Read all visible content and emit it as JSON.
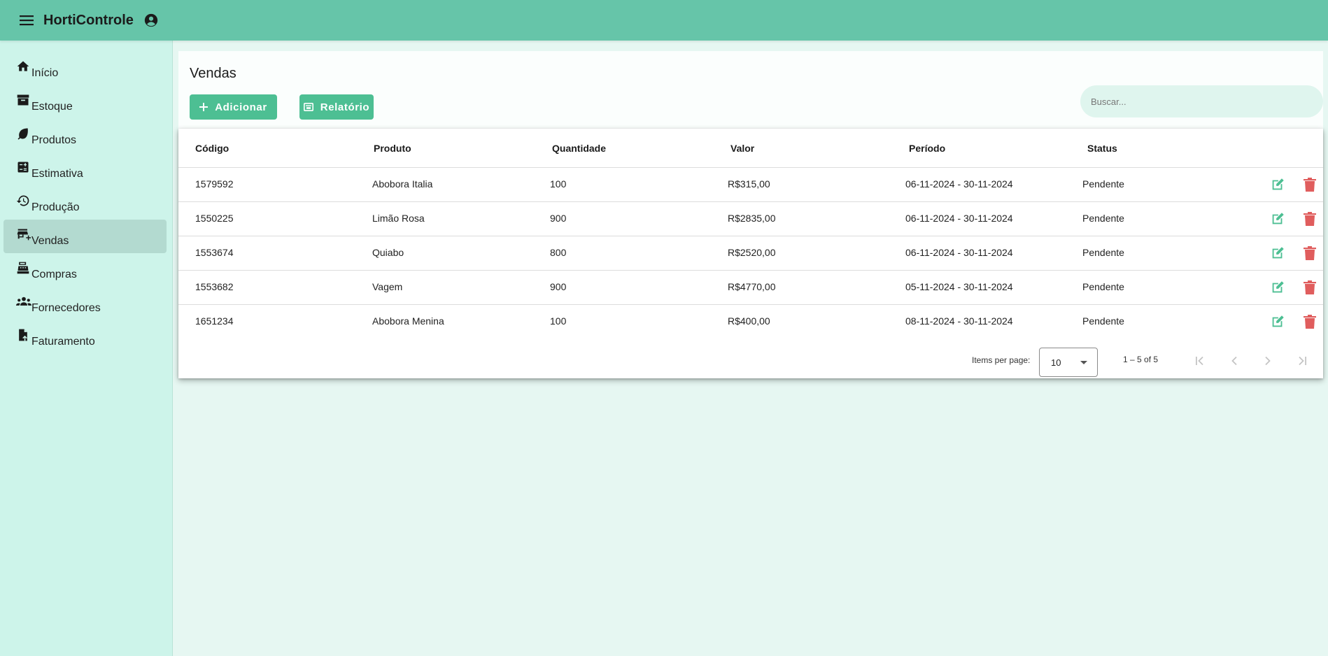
{
  "app": {
    "title": "HortiControle"
  },
  "sidebar": {
    "items": [
      {
        "label": "Início",
        "icon": "home-icon"
      },
      {
        "label": "Estoque",
        "icon": "archive-icon"
      },
      {
        "label": "Produtos",
        "icon": "leaf-icon"
      },
      {
        "label": "Estimativa",
        "icon": "calculator-icon"
      },
      {
        "label": "Produção",
        "icon": "history-icon"
      },
      {
        "label": "Vendas",
        "icon": "store-icon",
        "active": true
      },
      {
        "label": "Compras",
        "icon": "cash-register-icon"
      },
      {
        "label": "Fornecedores",
        "icon": "groups-icon"
      },
      {
        "label": "Faturamento",
        "icon": "file-invoice-icon"
      }
    ]
  },
  "page": {
    "title": "Vendas",
    "add_label": "Adicionar",
    "report_label": "Relatório",
    "search_placeholder": "Buscar..."
  },
  "table": {
    "headers": [
      "Código",
      "Produto",
      "Quantidade",
      "Valor",
      "Período",
      "Status"
    ],
    "rows": [
      [
        "1579592",
        "Abobora Italia",
        "100",
        "R$315,00",
        "06-11-2024 - 30-11-2024",
        "Pendente"
      ],
      [
        "1550225",
        "Limão Rosa",
        "900",
        "R$2835,00",
        "06-11-2024 - 30-11-2024",
        "Pendente"
      ],
      [
        "1553674",
        "Quiabo",
        "800",
        "R$2520,00",
        "06-11-2024 - 30-11-2024",
        "Pendente"
      ],
      [
        "1553682",
        "Vagem",
        "900",
        "R$4770,00",
        "05-11-2024 - 30-11-2024",
        "Pendente"
      ],
      [
        "1651234",
        "Abobora Menina",
        "100",
        "R$400,00",
        "08-11-2024 - 30-11-2024",
        "Pendente"
      ]
    ]
  },
  "paginator": {
    "items_per_page_label": "Items per page:",
    "page_size": "10",
    "range_label": "1 – 5 of 5"
  },
  "colors": {
    "topbar": "#66c5a9",
    "sidebar": "#cdf4ea",
    "accent": "#4dbf93",
    "edit": "#4dbf93",
    "delete": "#e05d5d"
  }
}
